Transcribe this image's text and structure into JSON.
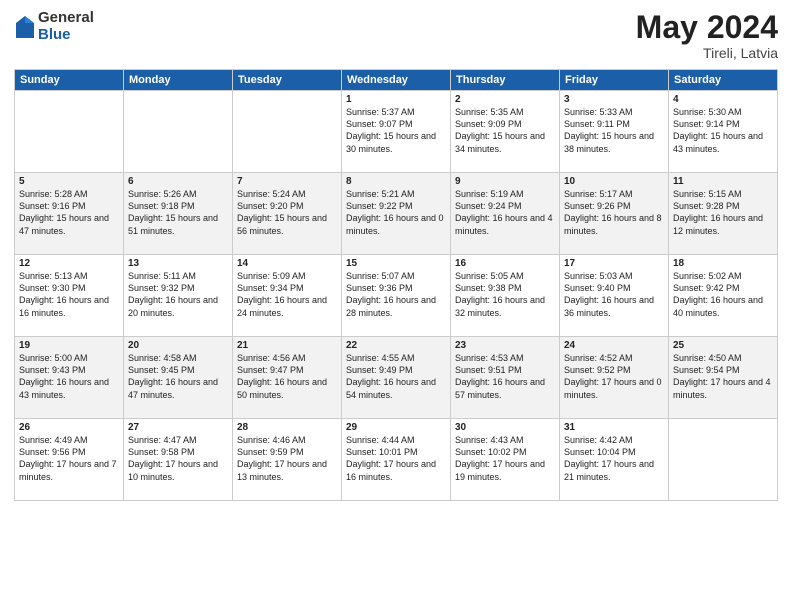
{
  "logo": {
    "general": "General",
    "blue": "Blue"
  },
  "title": "May 2024",
  "location": "Tireli, Latvia",
  "days_header": [
    "Sunday",
    "Monday",
    "Tuesday",
    "Wednesday",
    "Thursday",
    "Friday",
    "Saturday"
  ],
  "weeks": [
    [
      {
        "num": "",
        "info": ""
      },
      {
        "num": "",
        "info": ""
      },
      {
        "num": "",
        "info": ""
      },
      {
        "num": "1",
        "info": "Sunrise: 5:37 AM\nSunset: 9:07 PM\nDaylight: 15 hours\nand 30 minutes."
      },
      {
        "num": "2",
        "info": "Sunrise: 5:35 AM\nSunset: 9:09 PM\nDaylight: 15 hours\nand 34 minutes."
      },
      {
        "num": "3",
        "info": "Sunrise: 5:33 AM\nSunset: 9:11 PM\nDaylight: 15 hours\nand 38 minutes."
      },
      {
        "num": "4",
        "info": "Sunrise: 5:30 AM\nSunset: 9:14 PM\nDaylight: 15 hours\nand 43 minutes."
      }
    ],
    [
      {
        "num": "5",
        "info": "Sunrise: 5:28 AM\nSunset: 9:16 PM\nDaylight: 15 hours\nand 47 minutes."
      },
      {
        "num": "6",
        "info": "Sunrise: 5:26 AM\nSunset: 9:18 PM\nDaylight: 15 hours\nand 51 minutes."
      },
      {
        "num": "7",
        "info": "Sunrise: 5:24 AM\nSunset: 9:20 PM\nDaylight: 15 hours\nand 56 minutes."
      },
      {
        "num": "8",
        "info": "Sunrise: 5:21 AM\nSunset: 9:22 PM\nDaylight: 16 hours\nand 0 minutes."
      },
      {
        "num": "9",
        "info": "Sunrise: 5:19 AM\nSunset: 9:24 PM\nDaylight: 16 hours\nand 4 minutes."
      },
      {
        "num": "10",
        "info": "Sunrise: 5:17 AM\nSunset: 9:26 PM\nDaylight: 16 hours\nand 8 minutes."
      },
      {
        "num": "11",
        "info": "Sunrise: 5:15 AM\nSunset: 9:28 PM\nDaylight: 16 hours\nand 12 minutes."
      }
    ],
    [
      {
        "num": "12",
        "info": "Sunrise: 5:13 AM\nSunset: 9:30 PM\nDaylight: 16 hours\nand 16 minutes."
      },
      {
        "num": "13",
        "info": "Sunrise: 5:11 AM\nSunset: 9:32 PM\nDaylight: 16 hours\nand 20 minutes."
      },
      {
        "num": "14",
        "info": "Sunrise: 5:09 AM\nSunset: 9:34 PM\nDaylight: 16 hours\nand 24 minutes."
      },
      {
        "num": "15",
        "info": "Sunrise: 5:07 AM\nSunset: 9:36 PM\nDaylight: 16 hours\nand 28 minutes."
      },
      {
        "num": "16",
        "info": "Sunrise: 5:05 AM\nSunset: 9:38 PM\nDaylight: 16 hours\nand 32 minutes."
      },
      {
        "num": "17",
        "info": "Sunrise: 5:03 AM\nSunset: 9:40 PM\nDaylight: 16 hours\nand 36 minutes."
      },
      {
        "num": "18",
        "info": "Sunrise: 5:02 AM\nSunset: 9:42 PM\nDaylight: 16 hours\nand 40 minutes."
      }
    ],
    [
      {
        "num": "19",
        "info": "Sunrise: 5:00 AM\nSunset: 9:43 PM\nDaylight: 16 hours\nand 43 minutes."
      },
      {
        "num": "20",
        "info": "Sunrise: 4:58 AM\nSunset: 9:45 PM\nDaylight: 16 hours\nand 47 minutes."
      },
      {
        "num": "21",
        "info": "Sunrise: 4:56 AM\nSunset: 9:47 PM\nDaylight: 16 hours\nand 50 minutes."
      },
      {
        "num": "22",
        "info": "Sunrise: 4:55 AM\nSunset: 9:49 PM\nDaylight: 16 hours\nand 54 minutes."
      },
      {
        "num": "23",
        "info": "Sunrise: 4:53 AM\nSunset: 9:51 PM\nDaylight: 16 hours\nand 57 minutes."
      },
      {
        "num": "24",
        "info": "Sunrise: 4:52 AM\nSunset: 9:52 PM\nDaylight: 17 hours\nand 0 minutes."
      },
      {
        "num": "25",
        "info": "Sunrise: 4:50 AM\nSunset: 9:54 PM\nDaylight: 17 hours\nand 4 minutes."
      }
    ],
    [
      {
        "num": "26",
        "info": "Sunrise: 4:49 AM\nSunset: 9:56 PM\nDaylight: 17 hours\nand 7 minutes."
      },
      {
        "num": "27",
        "info": "Sunrise: 4:47 AM\nSunset: 9:58 PM\nDaylight: 17 hours\nand 10 minutes."
      },
      {
        "num": "28",
        "info": "Sunrise: 4:46 AM\nSunset: 9:59 PM\nDaylight: 17 hours\nand 13 minutes."
      },
      {
        "num": "29",
        "info": "Sunrise: 4:44 AM\nSunset: 10:01 PM\nDaylight: 17 hours\nand 16 minutes."
      },
      {
        "num": "30",
        "info": "Sunrise: 4:43 AM\nSunset: 10:02 PM\nDaylight: 17 hours\nand 19 minutes."
      },
      {
        "num": "31",
        "info": "Sunrise: 4:42 AM\nSunset: 10:04 PM\nDaylight: 17 hours\nand 21 minutes."
      },
      {
        "num": "",
        "info": ""
      }
    ]
  ]
}
